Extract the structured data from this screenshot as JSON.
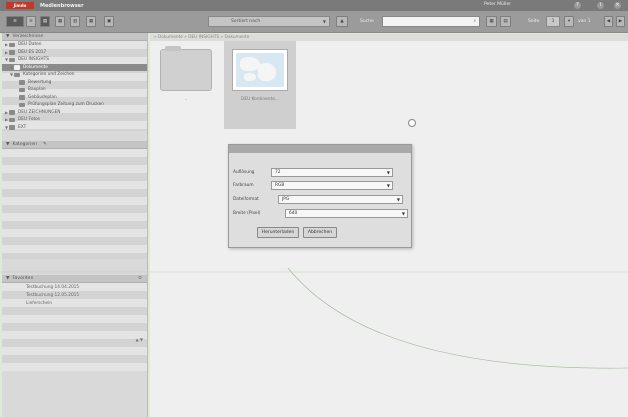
{
  "app": {
    "brand": "Jimdo",
    "title": "Medienbrowser",
    "user": "Peter Müller",
    "window_buttons": [
      "?",
      "i",
      "×"
    ]
  },
  "toolbar": {
    "buttons": [
      "≡",
      "≡",
      "▤",
      "▦",
      "▥",
      "▦",
      "▣"
    ],
    "sort_dropdown": "Sortiert nach",
    "upload_label": "▲",
    "search_label": "Suche",
    "search_value": "",
    "page_label": "Seite",
    "page_value": "1",
    "page_of": "von 1"
  },
  "sidebar": {
    "tree_header": "Verzeichnisse",
    "tree": [
      {
        "label": "DEU Daten",
        "twisty": "▶",
        "indent": 0,
        "selected": false
      },
      {
        "label": "DEU ES 2017",
        "twisty": "▶",
        "indent": 0,
        "selected": false
      },
      {
        "label": "DEU INSIGHTS",
        "twisty": "▼",
        "indent": 0,
        "selected": false
      },
      {
        "label": "Dokumente",
        "twisty": "▼",
        "indent": 1,
        "selected": true
      },
      {
        "label": "Kategorien und Zeichen",
        "twisty": "▼",
        "indent": 1,
        "selected": false
      },
      {
        "label": "Bewertung",
        "twisty": "",
        "indent": 2,
        "selected": false
      },
      {
        "label": "Bauplan",
        "twisty": "",
        "indent": 2,
        "selected": false
      },
      {
        "label": "Gebäudeplan",
        "twisty": "",
        "indent": 2,
        "selected": false
      },
      {
        "label": "Prüfungsplan Zeitung zum Drucken",
        "twisty": "",
        "indent": 2,
        "selected": false
      },
      {
        "label": "DEU ZEICHNUNGEN",
        "twisty": "▶",
        "indent": 0,
        "selected": false
      },
      {
        "label": "DEU Fotos",
        "twisty": "▶",
        "indent": 0,
        "selected": false
      },
      {
        "label": "EXT",
        "twisty": "▼",
        "indent": 0,
        "selected": false
      }
    ],
    "tags_header": "Kategorien",
    "tags_header_icon": "✎",
    "favorites_header": "Favoriten",
    "favorites": [
      "Testbuchung 14.04.2015",
      "Testbuchung 12.05.2015",
      "Lieferschein"
    ],
    "bottom_controls": "▲ ▼"
  },
  "breadcrumb": "» Dokumente » DEU INSIGHTS » Dokumente",
  "content": {
    "items": [
      {
        "kind": "folder",
        "label": ".."
      },
      {
        "kind": "image",
        "label": "DEU Kontinente..."
      }
    ]
  },
  "dialog": {
    "fields": [
      {
        "label": "Auflösung",
        "value": "72"
      },
      {
        "label": "Farbraum",
        "value": "RGB"
      },
      {
        "label": "Dateiformat",
        "value": "JPG"
      },
      {
        "label": "Breite (Pixel)",
        "value": "640"
      }
    ],
    "ok_label": "Herunterladen",
    "cancel_label": "Abbrechen"
  },
  "colors": {
    "accent": "#c0392b",
    "titlebar": "#7a7a7a",
    "toolbar": "#9b9b9b",
    "content_bg": "#efefef",
    "page_bg": "#dfe9d6"
  }
}
